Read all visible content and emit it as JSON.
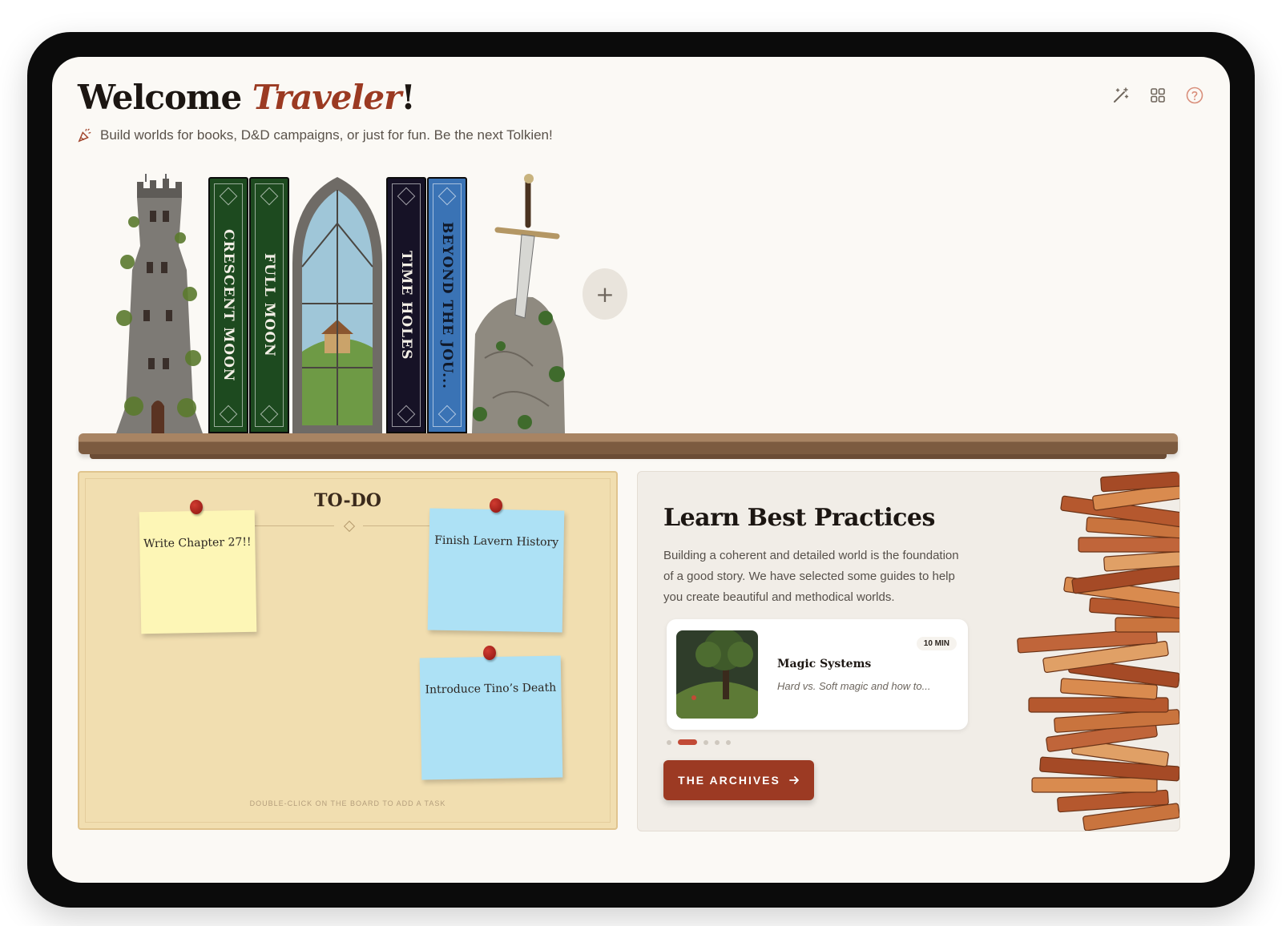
{
  "header": {
    "title_prefix": "Welcome ",
    "title_name": "Traveler",
    "title_suffix": "!",
    "subtitle": "Build worlds for books, D&D campaigns, or just for fun. Be the next Tolkien!"
  },
  "toolbar": {
    "icons": [
      "magic-wand-icon",
      "grid-icon",
      "help-icon"
    ]
  },
  "shelf": {
    "books": [
      {
        "title": "CRESCENT MOON",
        "color": "#1d4a1f"
      },
      {
        "title": "FULL MOON",
        "color": "#1d4a1f"
      },
      {
        "title": "TIME HOLES",
        "color": "#161226"
      },
      {
        "title": "BEYOND THE JOU...",
        "color": "#3a73b5"
      }
    ],
    "add_label": "+"
  },
  "todo": {
    "title": "TO-DO",
    "notes": [
      {
        "text": "Write Chapter 27!!",
        "color": "yellow"
      },
      {
        "text": "Finish Lavern History",
        "color": "blue"
      },
      {
        "text": "Introduce Tino’s Death",
        "color": "blue"
      }
    ],
    "hint": "DOUBLE-CLICK ON THE BOARD TO ADD A TASK"
  },
  "learn": {
    "title": "Learn Best Practices",
    "description": "Building a coherent and detailed world is the foundation of a good story. We have selected some guides to help you create beautiful and methodical worlds.",
    "guide": {
      "name": "Magic Systems",
      "subtitle": "Hard vs. Soft magic and how to...",
      "duration": "10 MIN"
    },
    "carousel": {
      "count": 5,
      "active": 1
    },
    "button_label": "THE ARCHIVES"
  },
  "colors": {
    "accent": "#9b3a22",
    "note_yellow": "#fdf6b6",
    "note_blue": "#ade1f5",
    "board": "#f1deb0"
  }
}
